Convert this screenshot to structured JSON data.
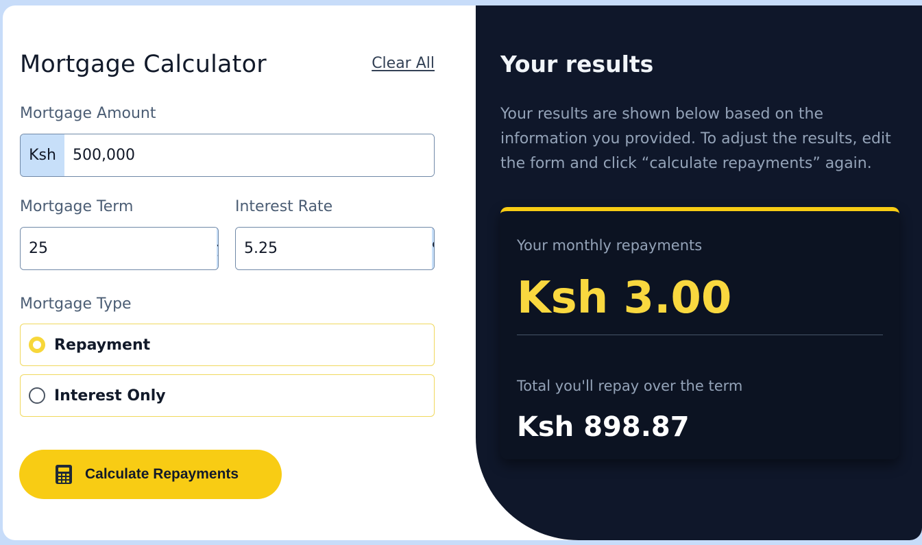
{
  "calculator": {
    "title": "Mortgage Calculator",
    "clear_all": "Clear All",
    "amount": {
      "label": "Mortgage Amount",
      "prefix": "Ksh",
      "value": "500,000"
    },
    "term": {
      "label": "Mortgage Term",
      "value": "25",
      "suffix": "years"
    },
    "rate": {
      "label": "Interest Rate",
      "value": "5.25",
      "suffix": "%"
    },
    "type": {
      "label": "Mortgage Type",
      "options": [
        {
          "label": "Repayment",
          "selected": true
        },
        {
          "label": "Interest Only",
          "selected": false
        }
      ]
    },
    "calculate_button": "Calculate Repayments",
    "calculate_icon": "calculator-icon"
  },
  "results": {
    "title": "Your results",
    "description": "Your results are shown below based on the information you provided. To adjust the results, edit the form and click “calculate repayments” again.",
    "monthly_label": "Your monthly repayments",
    "monthly_value": "Ksh 3.00",
    "total_label": "Total you'll repay over the term",
    "total_value": "Ksh 898.87"
  },
  "colors": {
    "accent": "#f8cc14",
    "dark_panel": "#0f172a",
    "addon_bg": "#c7dff9",
    "monthly_value": "#f9d83f"
  }
}
